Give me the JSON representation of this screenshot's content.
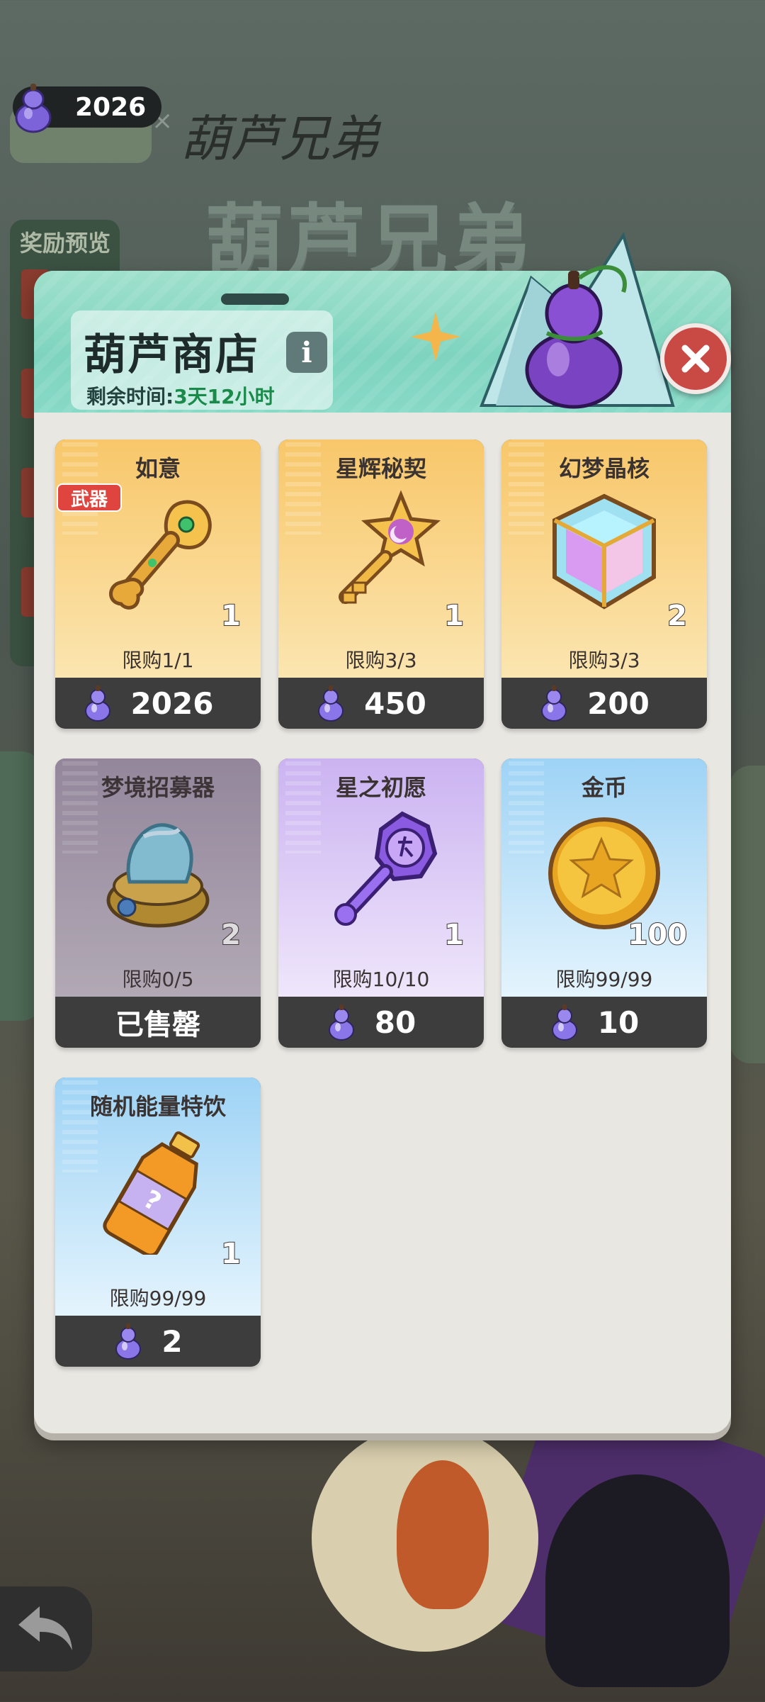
{
  "currency": {
    "amount": "2026",
    "icon": "gourd-icon"
  },
  "background": {
    "title_big": "葫芦兄弟",
    "title_script": "葫芦兄弟",
    "reward_tab": "奖励预览"
  },
  "shop": {
    "title": "葫芦商店",
    "timer_label": "剩余时间:",
    "timer_value": "3天12小时",
    "items": [
      {
        "name": "如意",
        "badge": "武器",
        "qty": "1",
        "limit": "限购1/1",
        "price": "2026",
        "theme": "orange",
        "icon": "ruyi-icon"
      },
      {
        "name": "星辉秘契",
        "qty": "1",
        "limit": "限购3/3",
        "price": "450",
        "theme": "orange",
        "icon": "star-key-icon"
      },
      {
        "name": "幻梦晶核",
        "qty": "2",
        "limit": "限购3/3",
        "price": "200",
        "theme": "orange",
        "icon": "crystal-cube-icon"
      },
      {
        "name": "梦境招募器",
        "qty": "2",
        "limit": "限购0/5",
        "status": "已售罄",
        "theme": "dim",
        "icon": "recruiter-icon"
      },
      {
        "name": "星之初愿",
        "qty": "1",
        "limit": "限购10/10",
        "price": "80",
        "theme": "purple",
        "icon": "purple-key-icon"
      },
      {
        "name": "金币",
        "qty": "100",
        "limit": "限购99/99",
        "price": "10",
        "theme": "blue",
        "icon": "gold-coin-icon"
      },
      {
        "name": "随机能量特饮",
        "qty": "1",
        "limit": "限购99/99",
        "price": "2",
        "theme": "blue",
        "icon": "energy-drink-icon"
      }
    ]
  },
  "colors": {
    "panel": "#e9e7e2",
    "header": "#7ed4bf",
    "close": "#c94a45",
    "timer_value": "#1a8a4a"
  }
}
